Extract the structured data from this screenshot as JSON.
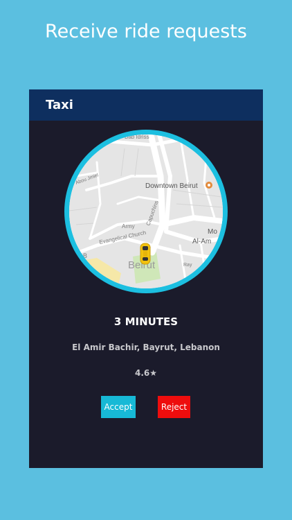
{
  "promo": {
    "title": "Receive ride requests"
  },
  "app": {
    "title": "Taxi"
  },
  "map": {
    "labels": {
      "bab_idriss": "Bab Idriss",
      "downtown": "Downtown Beirut",
      "capuchins": "Capuchins",
      "army": "Army",
      "evangelical": "Evangelical Church",
      "jmiel": "Abou Jmiel",
      "mo": "Mo",
      "alam": "Al-Am",
      "beirut": "Beirut",
      "small_b": "B",
      "ray": "Ray"
    }
  },
  "request": {
    "eta": "3 MINUTES",
    "address": "El Amir Bachir, Bayrut, Lebanon",
    "rating": "4.6★"
  },
  "actions": {
    "accept": "Accept",
    "reject": "Reject"
  },
  "colors": {
    "background": "#5bbfe0",
    "app_bar": "#0e2f5f",
    "panel": "#1b1b2b",
    "ring": "#1cbfe0",
    "accept": "#17b9d6",
    "reject": "#ee0d0d",
    "taxi": "#f2c20f"
  }
}
